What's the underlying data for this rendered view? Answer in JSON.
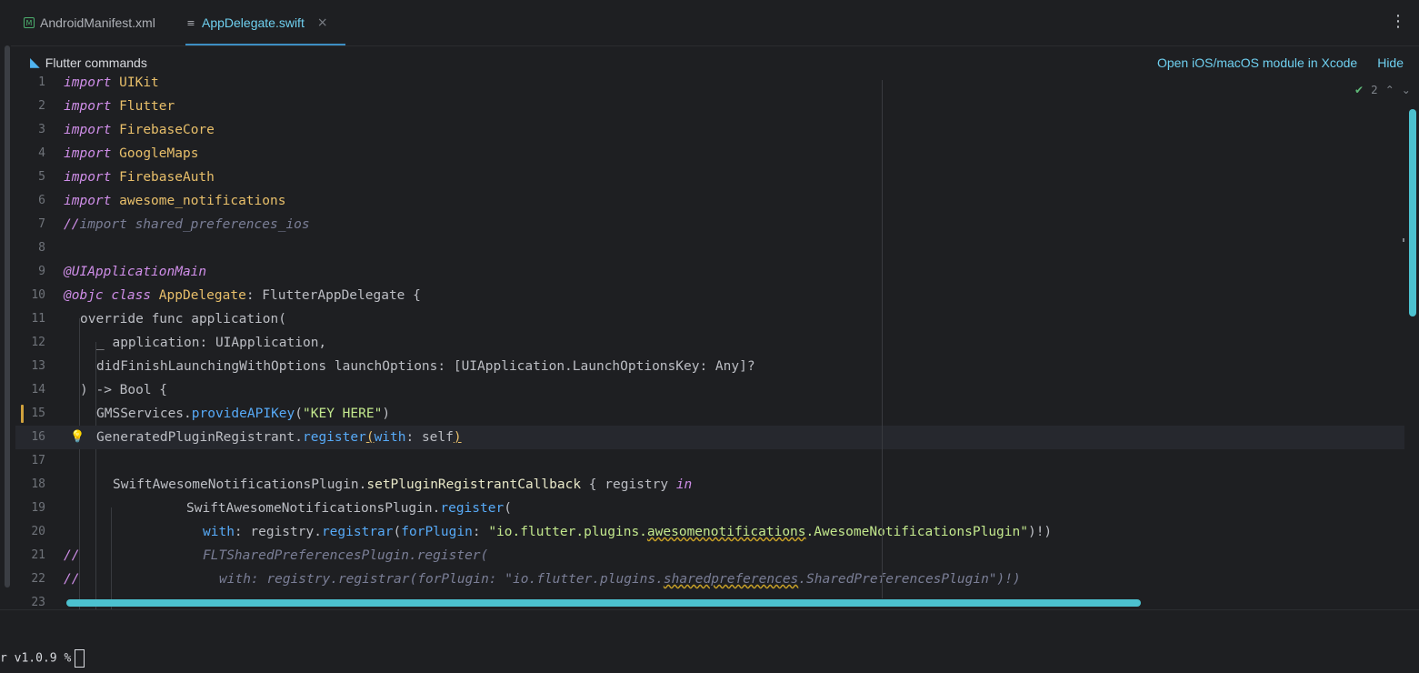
{
  "tabs": [
    {
      "label": "AndroidManifest.xml",
      "icon": "xml-file-icon",
      "active": false
    },
    {
      "label": "AppDelegate.swift",
      "icon": "swift-file-icon",
      "active": true
    }
  ],
  "banner": {
    "title": "Flutter commands",
    "open_xcode": "Open iOS/macOS module in Xcode",
    "hide": "Hide"
  },
  "inspection": {
    "count": "2"
  },
  "code_lines": [
    {
      "n": "1"
    },
    {
      "n": "2"
    },
    {
      "n": "3"
    },
    {
      "n": "4"
    },
    {
      "n": "5"
    },
    {
      "n": "6"
    },
    {
      "n": "7"
    },
    {
      "n": "8"
    },
    {
      "n": "9"
    },
    {
      "n": "10"
    },
    {
      "n": "11"
    },
    {
      "n": "12"
    },
    {
      "n": "13"
    },
    {
      "n": "14"
    },
    {
      "n": "15"
    },
    {
      "n": "16"
    },
    {
      "n": "17"
    },
    {
      "n": "18"
    },
    {
      "n": "19"
    },
    {
      "n": "20"
    },
    {
      "n": "21"
    },
    {
      "n": "22"
    },
    {
      "n": "23"
    }
  ],
  "code": {
    "l1_kw": "import",
    "l1_ty": "UIKit",
    "l2_kw": "import",
    "l2_ty": "Flutter",
    "l3_kw": "import",
    "l3_ty": "FirebaseCore",
    "l4_kw": "import",
    "l4_ty": "GoogleMaps",
    "l5_kw": "import",
    "l5_ty": "FirebaseAuth",
    "l6_kw": "import",
    "l6_ty": "awesome_notifications",
    "l7_cm": "//",
    "l7_txt": "import shared_preferences_ios",
    "l9_an": "@UIApplicationMain",
    "l10_an": "@objc",
    "l10_kw": "class",
    "l10_ty": "AppDelegate",
    "l10_rest": ": FlutterAppDelegate {",
    "l11": "override func application(",
    "l12": "_ application: UIApplication,",
    "l13": "didFinishLaunchingWithOptions launchOptions: [UIApplication.LaunchOptionsKey: Any]?",
    "l14": ") -> Bool {",
    "l15_a": "GMSServices.",
    "l15_fn": "provideAPIKey",
    "l15_p1": "(",
    "l15_st": "\"KEY HERE\"",
    "l15_p2": ")",
    "l16_a": "GeneratedPluginRegistrant.",
    "l16_fn": "register",
    "l16_b1": "(",
    "l16_kw": "with",
    "l16_rest": ": self",
    "l16_b2": ")",
    "l18_a": "SwiftAwesomeNotificationsPlugin.",
    "l18_mm": "setPluginRegistrantCallback",
    "l18_rest": " { registry ",
    "l18_kw": "in",
    "l19_a": "SwiftAwesomeNotificationsPlugin.",
    "l19_fn": "register",
    "l19_p": "(",
    "l20_kw": "with",
    "l20_a": ": registry.",
    "l20_fn": "registrar",
    "l20_p1": "(",
    "l20_kw2": "forPlugin",
    "l20_c": ": ",
    "l20_st1": "\"io.flutter.plugins.",
    "l20_st2": "awesomenotifications",
    "l20_st3": ".AwesomeNotificationsPlugin\"",
    "l20_end": ")!)",
    "l21_cm": "//",
    "l21_txt": "FLTSharedPreferencesPlugin.register(",
    "l22_cm": "//",
    "l22_a": "with: registry.registrar(forPlugin: \"io.flutter.plugins.",
    "l22_w": "sharedpreferences",
    "l22_b": ".SharedPreferencesPlugin\")!)"
  },
  "terminal": {
    "prompt": "r v1.0.9 %"
  }
}
